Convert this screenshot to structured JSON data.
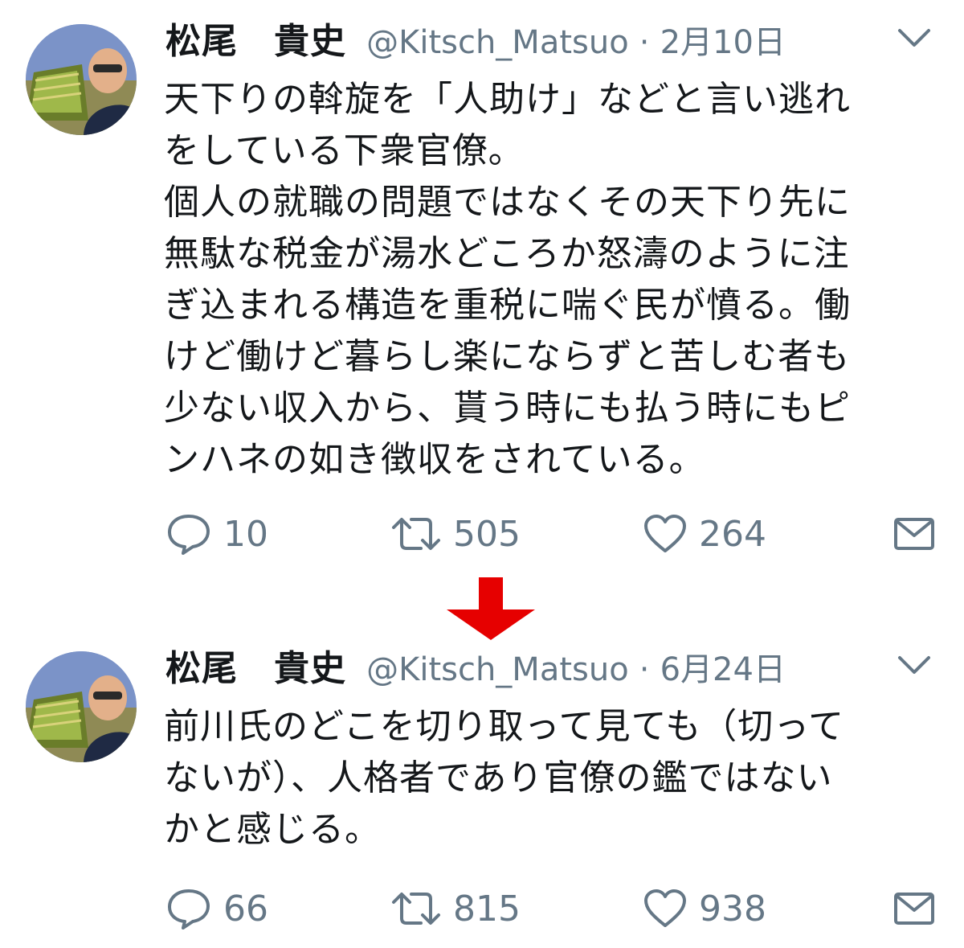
{
  "colors": {
    "text_primary": "#14171a",
    "text_secondary": "#657786",
    "arrow": "#e60000"
  },
  "tweets": [
    {
      "author": {
        "display_name": "松尾　貴史",
        "handle": "@Kitsch_Matsuo",
        "avatar": "profile-photo"
      },
      "separator": "·",
      "date": "2月10日",
      "text_lines": [
        "天下りの斡旋を「人助け」などと言い逃れ",
        "をしている下衆官僚。",
        "個人の就職の問題ではなくその天下り先に",
        "無駄な税金が湯水どころか怒濤のように注",
        "ぎ込まれる構造を重税に喘ぐ民が憤る。働",
        "けど働けど暮らし楽にならずと苦しむ者も",
        "少ない収入から、貰う時にも払う時にもピ",
        "ンハネの如き徴収をされている。"
      ],
      "actions": {
        "replies": "10",
        "retweets": "505",
        "likes": "264"
      },
      "icons": {
        "menu": "chevron-down-icon",
        "reply": "speech-bubble-icon",
        "retweet": "retweet-arrows-icon",
        "like": "heart-icon",
        "message": "envelope-icon"
      }
    },
    {
      "author": {
        "display_name": "松尾　貴史",
        "handle": "@Kitsch_Matsuo",
        "avatar": "profile-photo"
      },
      "separator": "·",
      "date": "6月24日",
      "text_lines": [
        "前川氏のどこを切り取って見ても（切って",
        "ないが）、人格者であり官僚の鑑ではない",
        "かと感じる。"
      ],
      "actions": {
        "replies": "66",
        "retweets": "815",
        "likes": "938"
      },
      "icons": {
        "menu": "chevron-down-icon",
        "reply": "speech-bubble-icon",
        "retweet": "retweet-arrows-icon",
        "like": "heart-icon",
        "message": "envelope-icon"
      }
    }
  ],
  "transition_arrow": "down-arrow-icon"
}
